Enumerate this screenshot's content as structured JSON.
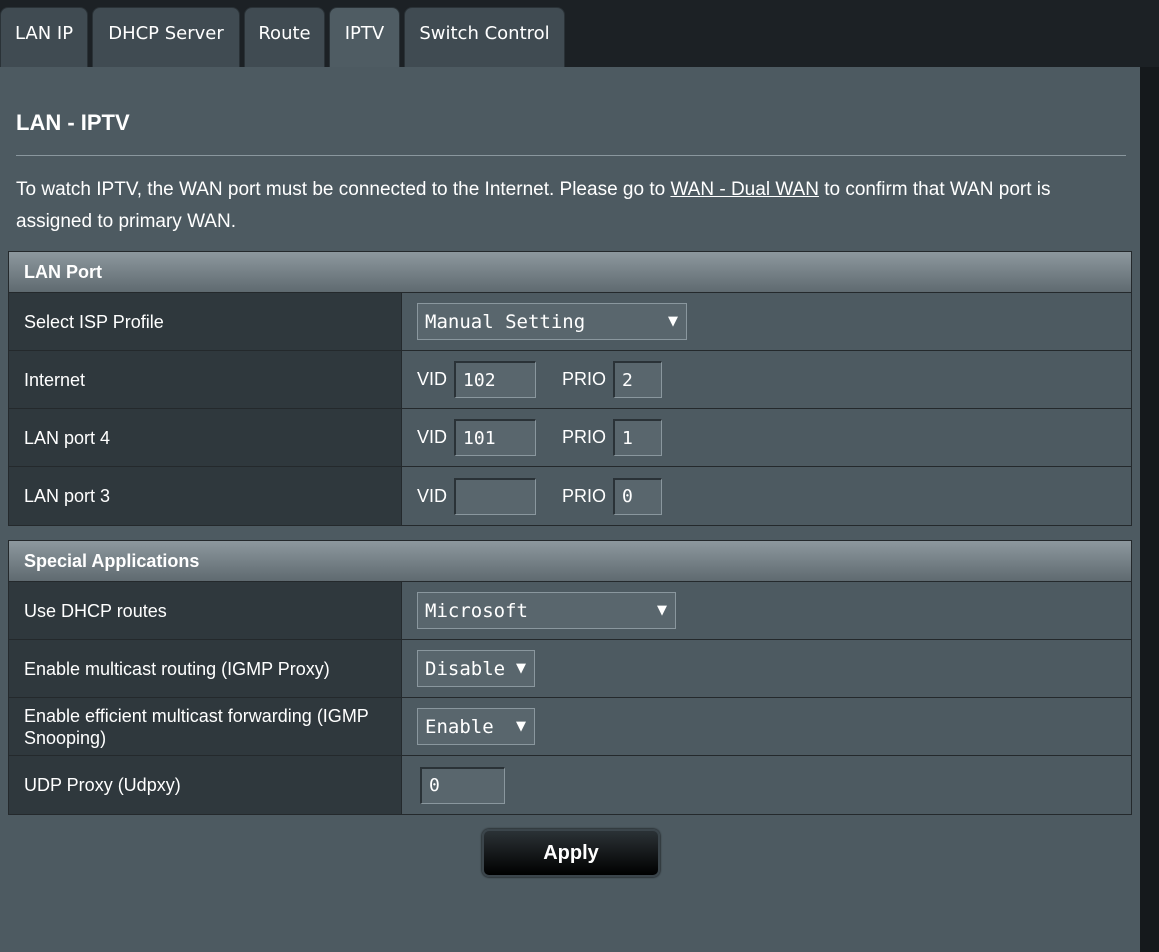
{
  "tabs": [
    {
      "label": "LAN IP"
    },
    {
      "label": "DHCP Server"
    },
    {
      "label": "Route"
    },
    {
      "label": "IPTV"
    },
    {
      "label": "Switch Control"
    }
  ],
  "page": {
    "title": "LAN - IPTV",
    "desc_before": "To watch IPTV, the WAN port must be connected to the Internet. Please go to ",
    "desc_link": "WAN - Dual WAN",
    "desc_after": " to confirm that WAN port is assigned to primary WAN."
  },
  "lan_port": {
    "header": "LAN Port",
    "isp_profile": {
      "label": "Select ISP Profile",
      "value": "Manual Setting"
    },
    "vid_label": "VID",
    "prio_label": "PRIO",
    "rows": [
      {
        "label": "Internet",
        "vid": "102",
        "prio": "2"
      },
      {
        "label": "LAN port 4",
        "vid": "101",
        "prio": "1"
      },
      {
        "label": "LAN port 3",
        "vid": "",
        "prio": "0"
      }
    ]
  },
  "special": {
    "header": "Special Applications",
    "dhcp_routes": {
      "label": "Use DHCP routes",
      "value": "Microsoft"
    },
    "igmp_proxy": {
      "label": "Enable multicast routing (IGMP Proxy)",
      "value": "Disable"
    },
    "igmp_snooping": {
      "label": "Enable efficient multicast forwarding (IGMP Snooping)",
      "value": "Enable"
    },
    "udpxy": {
      "label": "UDP Proxy (Udpxy)",
      "value": "0"
    }
  },
  "apply_label": "Apply",
  "icons": {
    "dropdown": "caret-down-icon"
  },
  "colors": {
    "panel": "#4d5a61",
    "label_cell": "#2f383d",
    "header": "#8d989e"
  }
}
